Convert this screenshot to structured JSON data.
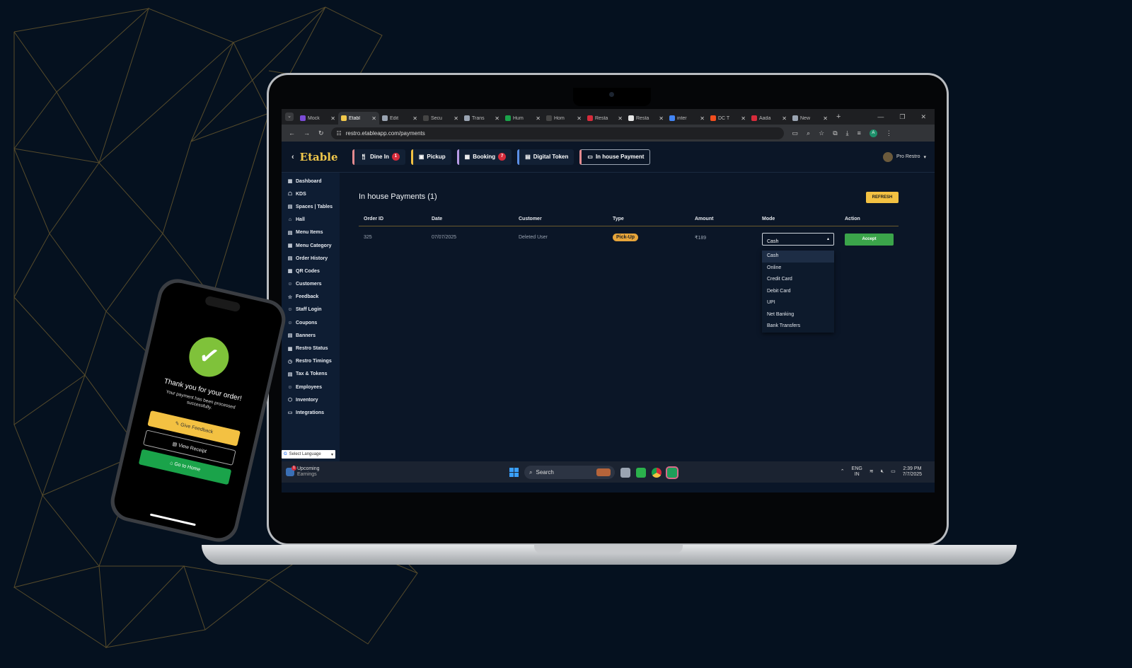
{
  "browser": {
    "tabs": [
      {
        "label": "Mock",
        "color": "#7b4bd6"
      },
      {
        "label": "Etabl",
        "color": "#f1c84b",
        "active": true
      },
      {
        "label": "Edit",
        "color": "#9aa4b2"
      },
      {
        "label": "Secu",
        "color": "#444"
      },
      {
        "label": "Trans",
        "color": "#9aa4b2"
      },
      {
        "label": "Hum",
        "color": "#1aa34a"
      },
      {
        "label": "Hom",
        "color": "#444"
      },
      {
        "label": "Resta",
        "color": "#d62b3b"
      },
      {
        "label": "Resta",
        "color": "#e6e6e6"
      },
      {
        "label": "inter",
        "color": "#4285f4"
      },
      {
        "label": "DC T",
        "color": "#f24e1e"
      },
      {
        "label": "Aada",
        "color": "#d62b3b"
      },
      {
        "label": "New",
        "color": "#9aa4b2"
      }
    ],
    "url": "restro.etableapp.com/payments",
    "avatar_letter": "A"
  },
  "app": {
    "logo": "Etable",
    "nav_tabs": [
      {
        "label": "Dine In",
        "badge": "1",
        "accent": "#e38a8f"
      },
      {
        "label": "Pickup",
        "badge": "",
        "accent": "#f3c142"
      },
      {
        "label": "Booking",
        "badge": "7",
        "accent": "#b89be6"
      },
      {
        "label": "Digital Token",
        "badge": "",
        "accent": "#5b8fe6"
      },
      {
        "label": "In house Payment",
        "badge": "",
        "accent": "#e38a8f",
        "active": true
      }
    ],
    "profile_name": "Pro Restro",
    "sidebar": [
      "Dashboard",
      "KDS",
      "Spaces | Tables",
      "Hall",
      "Menu Items",
      "Menu Category",
      "Order History",
      "QR Codes",
      "Customers",
      "Feedback",
      "Staff Login",
      "Coupons",
      "Banners",
      "Restro Status",
      "Restro Timings",
      "Tax & Tokens",
      "Employees",
      "Inventory",
      "Integrations"
    ],
    "select_language": "Select Language",
    "page_title": "In house Payments (1)",
    "refresh_label": "REFRESH",
    "columns": [
      "Order ID",
      "Date",
      "Customer",
      "Type",
      "Amount",
      "Mode",
      "Action"
    ],
    "row": {
      "order_id": "325",
      "date": "07/07/2025",
      "customer": "Deleted User",
      "type": "Pick-Up",
      "amount": "₹189",
      "mode": "Cash",
      "action": "Accept"
    },
    "mode_options": [
      "Cash",
      "Online",
      "Credit Card",
      "Debit Card",
      "UPI",
      "Net Banking",
      "Bank Transfers"
    ]
  },
  "taskbar": {
    "weather_title": "Upcoming",
    "weather_sub": "Earnings",
    "weather_badge": "1",
    "search": "Search",
    "lang": "ENG",
    "region": "IN",
    "time": "2:39 PM",
    "date": "7/7/2025"
  },
  "phone": {
    "title": "Thank you for your order!",
    "subtitle": "Your payment has been processed successfully.",
    "btn_feedback": "Give Feedback",
    "btn_receipt": "View Receipt",
    "btn_home": "Go to Home"
  }
}
